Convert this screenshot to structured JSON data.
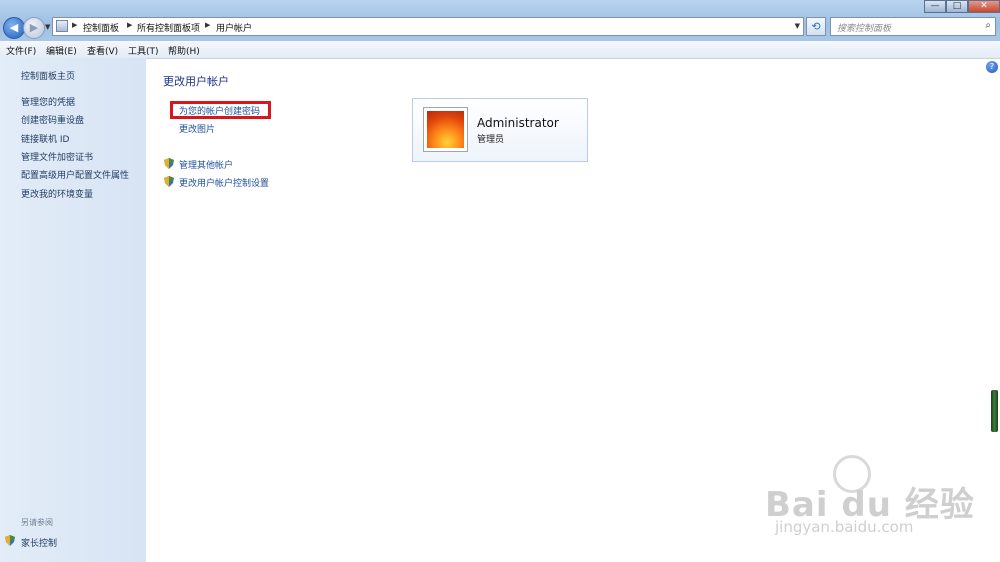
{
  "window": {
    "minimize_glyph": "—",
    "maximize_glyph": "□",
    "close_glyph": "✕"
  },
  "address_bar": {
    "breadcrumbs": [
      "控制面板",
      "所有控制面板项",
      "用户帐户"
    ],
    "search_placeholder": "搜索控制面板"
  },
  "menubar": {
    "items": [
      "文件(F)",
      "编辑(E)",
      "查看(V)",
      "工具(T)",
      "帮助(H)"
    ]
  },
  "sidebar": {
    "home": "控制面板主页",
    "links": [
      "管理您的凭据",
      "创建密码重设盘",
      "链接联机 ID",
      "管理文件加密证书",
      "配置高级用户配置文件属性",
      "更改我的环境变量"
    ],
    "see_also_label": "另请参阅",
    "parental_controls": "家长控制"
  },
  "main": {
    "title": "更改用户帐户",
    "create_password": "为您的帐户创建密码",
    "change_picture": "更改图片",
    "manage_other": "管理其他帐户",
    "uac_settings": "更改用户帐户控制设置"
  },
  "account": {
    "name": "Administrator",
    "role": "管理员"
  },
  "watermark": {
    "main": "Bai du 经验",
    "sub": "jingyan.baidu.com"
  }
}
